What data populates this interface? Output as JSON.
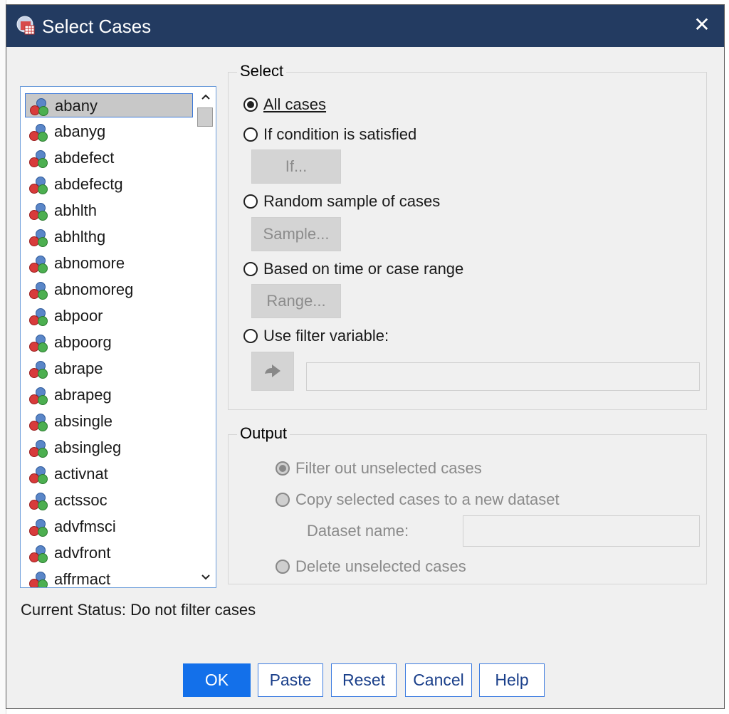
{
  "window": {
    "title": "Select Cases",
    "close_glyph": "✕"
  },
  "variables": [
    {
      "name": "abany",
      "selected": true
    },
    {
      "name": "abanyg"
    },
    {
      "name": "abdefect"
    },
    {
      "name": "abdefectg"
    },
    {
      "name": "abhlth"
    },
    {
      "name": "abhlthg"
    },
    {
      "name": "abnomore"
    },
    {
      "name": "abnomoreg"
    },
    {
      "name": "abpoor"
    },
    {
      "name": "abpoorg"
    },
    {
      "name": "abrape"
    },
    {
      "name": "abrapeg"
    },
    {
      "name": "absingle"
    },
    {
      "name": "absingleg"
    },
    {
      "name": "activnat"
    },
    {
      "name": "actssoc"
    },
    {
      "name": "advfmsci"
    },
    {
      "name": "advfront"
    },
    {
      "name": "affrmact"
    }
  ],
  "select_group": {
    "title": "Select",
    "all_cases": "All cases",
    "if_condition": "If condition is satisfied",
    "if_button": "If...",
    "random_sample": "Random sample of cases",
    "sample_button": "Sample...",
    "time_range": "Based on time or case range",
    "range_button": "Range...",
    "filter_variable": "Use filter variable:",
    "selected_option": "All cases"
  },
  "output_group": {
    "title": "Output",
    "filter_out": "Filter out unselected cases",
    "copy_selected": "Copy selected cases to a new dataset",
    "dataset_name_label": "Dataset name:",
    "dataset_name_value": "",
    "delete_unselected": "Delete unselected cases"
  },
  "status": "Current Status: Do not filter cases",
  "buttons": {
    "ok": "OK",
    "paste": "Paste",
    "reset": "Reset",
    "cancel": "Cancel",
    "help": "Help"
  },
  "colors": {
    "titlebar": "#233b61",
    "primary_button": "#1370ea",
    "dialog_bg": "#f0f0f0"
  },
  "icons": {
    "title": "spss-select-cases-icon",
    "variable": "nominal-variable-icon",
    "filter_arrow": "arrow-right-icon"
  }
}
